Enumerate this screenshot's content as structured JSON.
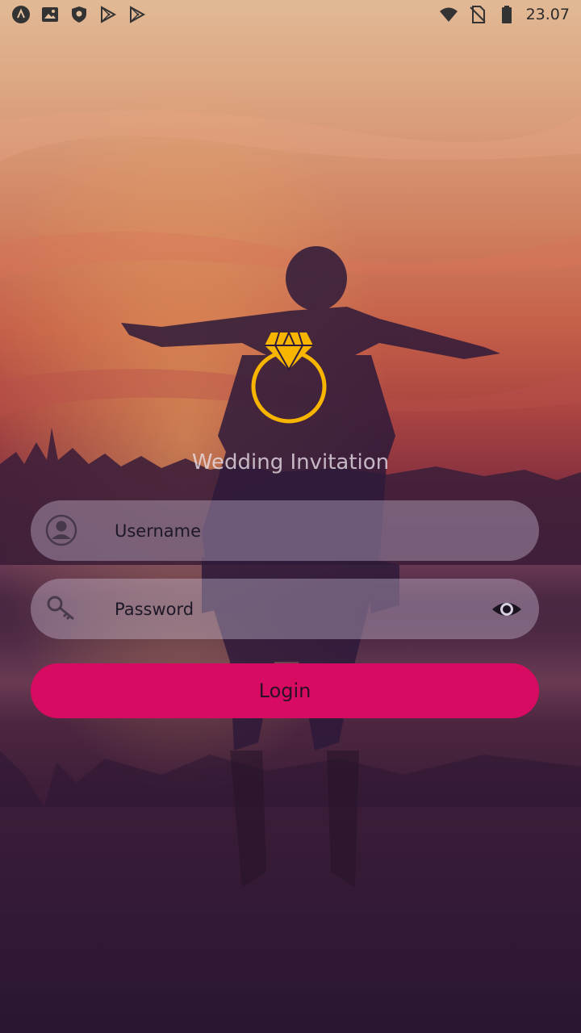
{
  "status_bar": {
    "time": "23.07",
    "left_icons": [
      "app-logo-icon",
      "gallery-icon",
      "shield-icon",
      "play-store-icon",
      "play-store-icon"
    ],
    "right_icons": [
      "wifi-icon",
      "no-sim-icon",
      "battery-icon"
    ]
  },
  "login": {
    "title": "Wedding Invitation",
    "logo_icon": "diamond-ring-icon",
    "username_placeholder": "Username",
    "password_placeholder": "Password",
    "button_label": "Login",
    "username_icon": "user-avatar-icon",
    "password_icon": "key-icon",
    "visibility_icon": "eye-icon"
  },
  "colors": {
    "accent": "#d80b62",
    "logo": "#f7b500",
    "field_background": "rgba(225,215,240,0.34)"
  }
}
